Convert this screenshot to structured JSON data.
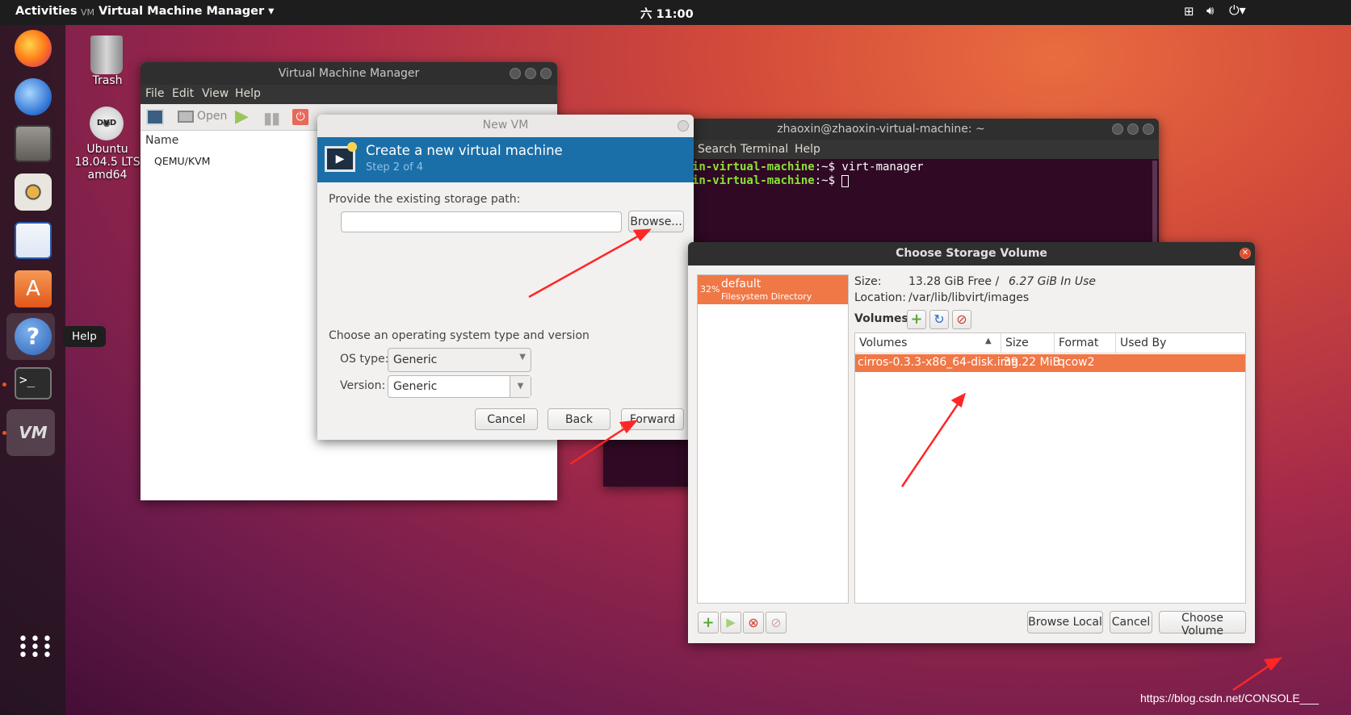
{
  "topbar": {
    "activities": "Activities",
    "app_menu": "Virtual Machine Manager ▾",
    "clock": "六 11:00",
    "network_icon": "network-icon",
    "volume_icon": "volume-icon",
    "power_icon": "power-icon"
  },
  "dock": {
    "tooltip": "Help",
    "apps": [
      "firefox-icon",
      "thunderbird-icon",
      "files-icon",
      "rhythmbox-icon",
      "libreoffice-writer-icon",
      "ubuntu-software-icon",
      "help-icon",
      "terminal-icon",
      "virt-manager-icon"
    ],
    "show_apps_icon": "show-apps-icon"
  },
  "desktop": {
    "trash": "Trash",
    "dvd_line1": "Ubuntu",
    "dvd_line2": "18.04.5 LTS",
    "dvd_line3": "amd64"
  },
  "vmm": {
    "title": "Virtual Machine Manager",
    "menu": [
      "File",
      "Edit",
      "View",
      "Help"
    ],
    "open": "Open",
    "col_name": "Name",
    "conn": "QEMU/KVM"
  },
  "newvm": {
    "title": "New VM",
    "header": "Create a new virtual machine",
    "step": "Step 2 of 4",
    "storage_label": "Provide the existing storage path:",
    "storage_value": "",
    "browse": "Browse...",
    "os_heading": "Choose an operating system type and version",
    "os_type_label": "OS type:",
    "os_type_value": "Generic",
    "version_label": "Version:",
    "version_value": "Generic",
    "cancel": "Cancel",
    "back": "Back",
    "forward": "Forward"
  },
  "terminal": {
    "title": "zhaoxin@zhaoxin-virtual-machine: ~",
    "menu": [
      "Search",
      "Terminal",
      "Help"
    ],
    "line1_host": "in-virtual-machine",
    "line1_cmd": ":~$ virt-manager",
    "line2_host": "in-virtual-machine",
    "line2_cmd": ":~$ "
  },
  "storage": {
    "title": "Choose Storage Volume",
    "pool_pct": "32%",
    "pool_name": "default",
    "pool_type": "Filesystem Directory",
    "size_label": "Size:",
    "size_free": "13.28 GiB Free /",
    "size_used": "6.27 GiB In Use",
    "loc_label": "Location:",
    "loc_value": "/var/lib/libvirt/images",
    "volumes_label": "Volumes",
    "cols": [
      "Volumes",
      "Size",
      "Format",
      "Used By"
    ],
    "row": {
      "name": "cirros-0.3.3-x86_64-disk.img",
      "size": "39.22 MiB",
      "format": "qcow2",
      "used": ""
    },
    "browse_local": "Browse Local",
    "cancel": "Cancel",
    "choose": "Choose Volume"
  },
  "watermark": "https://blog.csdn.net/CONSOLE___",
  "colors": {
    "accent": "#e95420",
    "selection": "#f07746",
    "header_blue": "#1b6fa8",
    "terminal_bg": "#300a24",
    "prompt_green": "#8ae234"
  }
}
